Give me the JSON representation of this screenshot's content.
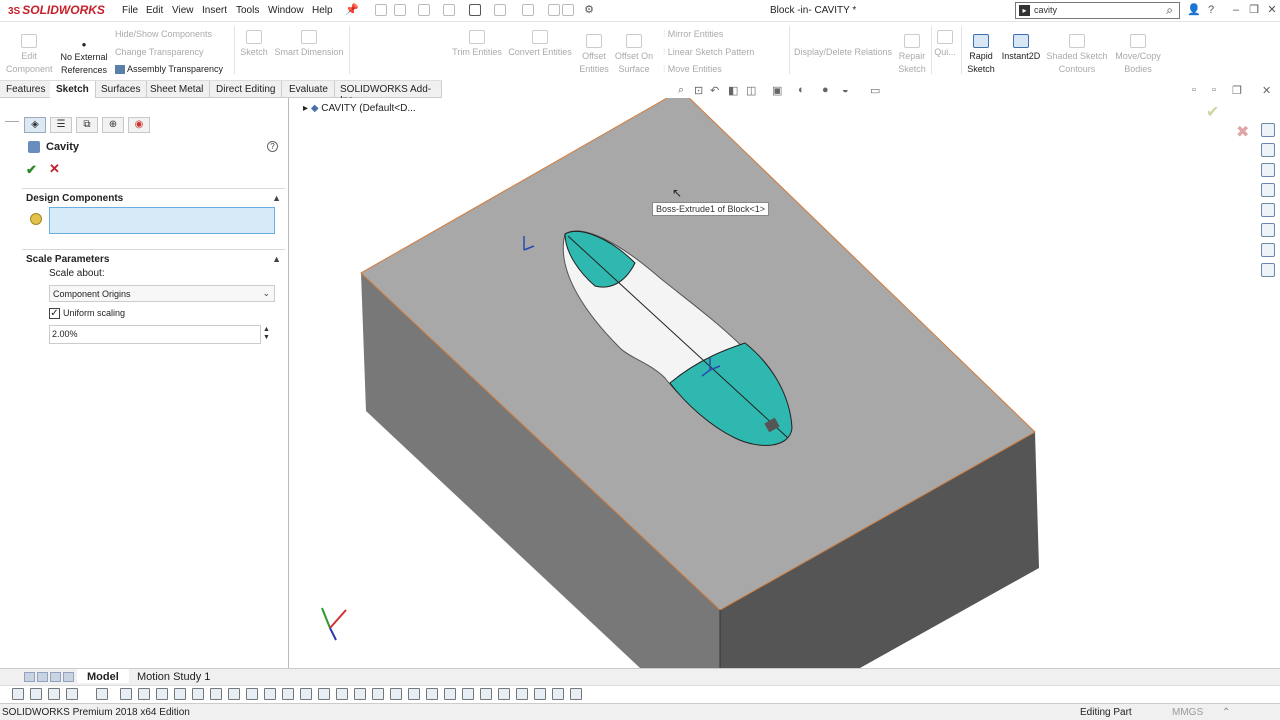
{
  "app": {
    "logo_prefix": "3S",
    "logo": "SOLIDWORKS"
  },
  "menu": [
    "File",
    "Edit",
    "View",
    "Insert",
    "Tools",
    "Window",
    "Help"
  ],
  "document_title": "Block -in- CAVITY *",
  "search": {
    "value": "cavity"
  },
  "commands": {
    "edit_component": "Edit Component",
    "no_external": "No External",
    "references": "References",
    "hide_show": "Hide/Show Components",
    "change_transparency": "Change Transparency",
    "assembly_transparency": "Assembly Transparency",
    "sketch": "Sketch",
    "smart_dimension": "Smart Dimension",
    "trim_entities": "Trim Entities",
    "convert_entities": "Convert Entities",
    "offset_entities": "Offset Entities",
    "offset_surface": "Offset On Surface",
    "mirror_entities": "Mirror Entities",
    "linear_pattern": "Linear Sketch Pattern",
    "move_entities": "Move Entities",
    "display_delete": "Display/Delete Relations",
    "repair_sketch": "Repair Sketch",
    "quick": "Qui...",
    "rapid_sketch": "Rapid Sketch",
    "instant2d": "Instant2D",
    "shaded_contours": "Shaded Sketch Contours",
    "move_copy": "Move/Copy Bodies"
  },
  "tabs": [
    "Features",
    "Sketch",
    "Surfaces",
    "Sheet Metal",
    "Direct Editing",
    "Evaluate",
    "SOLIDWORKS Add-Ins"
  ],
  "active_tab": "Sketch",
  "property_manager": {
    "title": "Cavity",
    "design_components_label": "Design Components",
    "scale_params_label": "Scale Parameters",
    "scale_about_label": "Scale about:",
    "scale_about_value": "Component Origins",
    "uniform_scaling_label": "Uniform scaling",
    "uniform_scaling_checked": true,
    "scale_value": "2.00%"
  },
  "tree": {
    "item": "CAVITY  (Default<D..."
  },
  "tooltip": "Boss-Extrude1 of Block<1>",
  "bottom_tabs": [
    "Model",
    "Motion Study 1"
  ],
  "status": {
    "left": "SOLIDWORKS Premium 2018 x64 Edition",
    "mode": "Editing Part",
    "units": "MMGS"
  },
  "colors": {
    "accent": "#3a6fb0",
    "face_cyan": "#2fb8b0",
    "box_top": "#a9a9a9",
    "edge": "#d27b3a"
  }
}
